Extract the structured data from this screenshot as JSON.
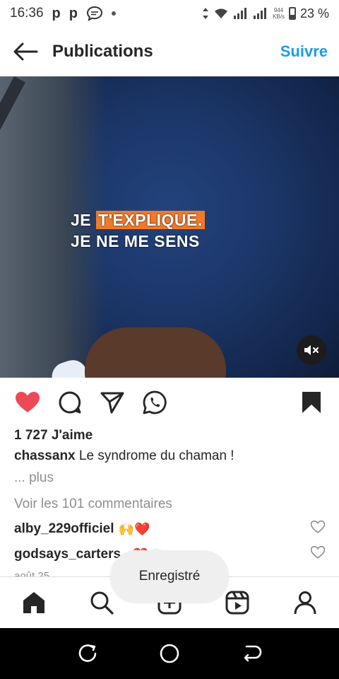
{
  "status_bar": {
    "time": "16:36",
    "app_icons": [
      "p-icon",
      "p-icon",
      "message-icon"
    ],
    "network_speed_top": "944",
    "network_speed_bottom": "KB/s",
    "battery": "23 %"
  },
  "header": {
    "title": "Publications",
    "follow_label": "Suivre"
  },
  "media": {
    "overlay_line1_a": "JE ",
    "overlay_line1_b": "T'EXPLIQUE.",
    "overlay_line2": "JE NE ME SENS",
    "muted": true
  },
  "post": {
    "likes": "1 727 J'aime",
    "author": "chassanx",
    "caption": "Le syndrome du chaman !",
    "more": "... plus",
    "view_comments": "Voir les 101 commentaires",
    "comments": [
      {
        "user": "alby_229officiel",
        "text": "🙌❤️"
      },
      {
        "user": "godsays_carters_",
        "text": "❤️🙌"
      }
    ],
    "date": "août 25",
    "liked": true,
    "saved": true
  },
  "toast": {
    "text": "Enregistré"
  },
  "colors": {
    "accent": "#1a9bf0",
    "like_red": "#ed4956",
    "muted_text": "#8e8e8e"
  }
}
